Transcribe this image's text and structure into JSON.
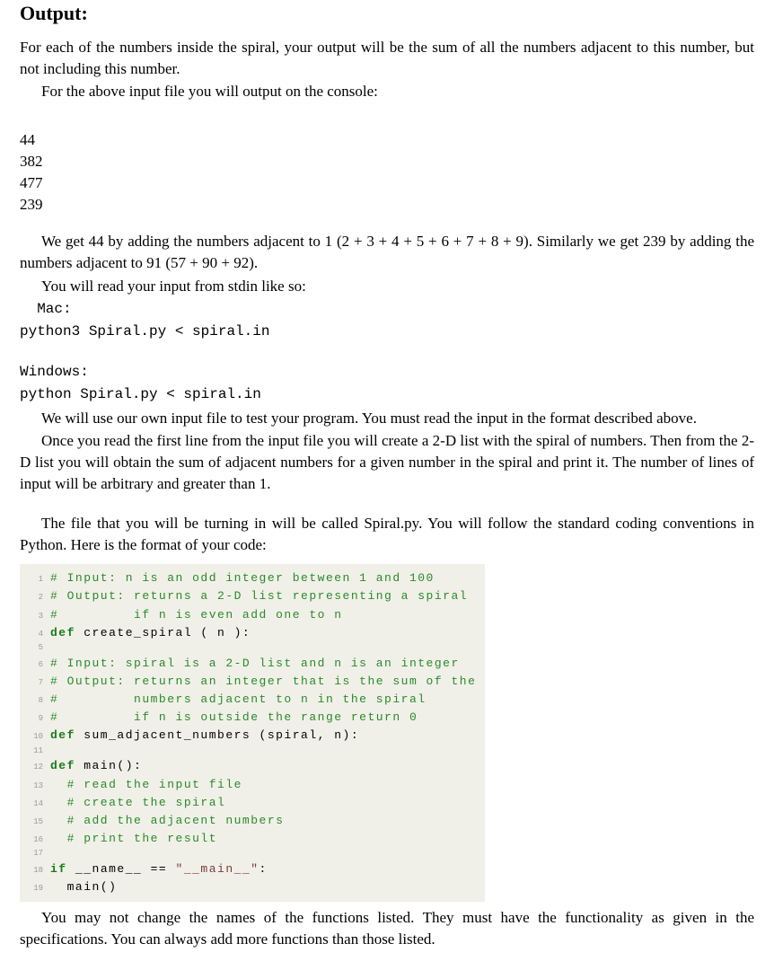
{
  "heading": "Output:",
  "p1": "For each of the numbers inside the spiral, your output will be the sum of all the numbers adjacent to this number, but not including this number.",
  "p2": "For the above input file you will output on the console:",
  "sample_output": [
    "44",
    "382",
    "477",
    "239"
  ],
  "p3": "We get 44 by adding the numbers adjacent to 1 (2 + 3 + 4 + 5 + 6 + 7 + 8 + 9). Similarly we get 239 by adding the numbers adjacent to 91 (57 + 90 + 92).",
  "p4": "You will read your input from stdin like so:",
  "mac_label": "  Mac:",
  "mac_cmd": "python3 Spiral.py < spiral.in",
  "win_label": "Windows:",
  "win_cmd": "python Spiral.py < spiral.in",
  "p5": "We will use our own input file to test your program. You must read the input in the format described above.",
  "p6": "Once you read the first line from the input file you will create a 2-D list with the spiral of numbers. Then from the 2-D list you will obtain the sum of adjacent numbers for a given number in the spiral and print it. The number of lines of input will be arbitrary and greater than 1.",
  "p7": "The file that you will be turning in will be called Spiral.py. You will follow the standard coding conventions in Python. Here is the format of your code:",
  "code": {
    "l1": {
      "n": "1",
      "comment": "# Input: n is an odd integer between 1 and 100"
    },
    "l2": {
      "n": "2",
      "comment": "# Output: returns a 2-D list representing a spiral"
    },
    "l3": {
      "n": "3",
      "comment": "#         if n is even add one to n"
    },
    "l4": {
      "n": "4",
      "kw": "def",
      "name": " create_spiral ( n ):"
    },
    "l5": {
      "n": "5"
    },
    "l6": {
      "n": "6",
      "comment": "# Input: spiral is a 2-D list and n is an integer"
    },
    "l7": {
      "n": "7",
      "comment": "# Output: returns an integer that is the sum of the"
    },
    "l8": {
      "n": "8",
      "comment": "#         numbers adjacent to n in the spiral"
    },
    "l9": {
      "n": "9",
      "comment": "#         if n is outside the range return 0"
    },
    "l10": {
      "n": "10",
      "kw": "def",
      "name": " sum_adjacent_numbers (spiral, n):"
    },
    "l11": {
      "n": "11"
    },
    "l12": {
      "n": "12",
      "kw": "def",
      "name": " main():"
    },
    "l13": {
      "n": "13",
      "comment": "  # read the input file"
    },
    "l14": {
      "n": "14",
      "comment": "  # create the spiral"
    },
    "l15": {
      "n": "15",
      "comment": "  # add the adjacent numbers"
    },
    "l16": {
      "n": "16",
      "comment": "  # print the result"
    },
    "l17": {
      "n": "17"
    },
    "l18": {
      "n": "18",
      "kw": "if",
      "name": " __name__ == ",
      "str": "\"__main__\"",
      "tail": ":"
    },
    "l19": {
      "n": "19",
      "body": "  main()"
    }
  },
  "p8": "You may not change the names of the functions listed. They must have the functionality as given in the specifications. You can always add more functions than those listed."
}
